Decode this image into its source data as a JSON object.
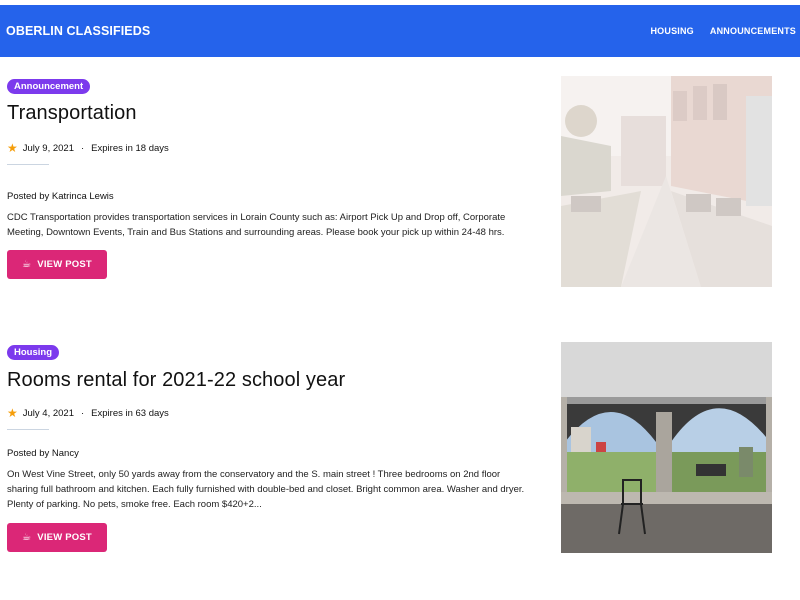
{
  "header": {
    "brand": "OBERLIN CLASSIFIEDS",
    "nav": [
      "HOUSING",
      "ANNOUNCEMENTS"
    ]
  },
  "posts": [
    {
      "badge": "Announcement",
      "title": "Transportation",
      "date": "July 9, 2021",
      "expires": "Expires in 18 days",
      "author": "Posted by Katrinca Lewis",
      "description": "CDC Transportation provides transportation services in Lorain County such as: Airport Pick Up and Drop off, Corporate Meeting, Downtown Events, Train and Bus Stations and surrounding areas. Please book your pick up within 24-48 hrs.",
      "button": "VIEW POST",
      "image": "street-scene-photo"
    },
    {
      "badge": "Housing",
      "title": "Rooms rental for 2021-22 school year",
      "date": "July 4, 2021",
      "expires": "Expires in 63 days",
      "author": "Posted by Nancy",
      "description": "On West Vine Street, only 50 yards away from the conservatory and the S. main street !  Three bedrooms on 2nd floor sharing full bathroom and kitchen. Each fully furnished with double-bed and closet. Bright common area. Washer and dryer. Plenty of parking. No pets, smoke free. Each room $420+2...",
      "button": "VIEW POST",
      "image": "porch-view-photo"
    }
  ],
  "colors": {
    "header": "#2563eb",
    "badge": "#7c3aed",
    "button": "#db2777",
    "star": "#f59e0b"
  }
}
